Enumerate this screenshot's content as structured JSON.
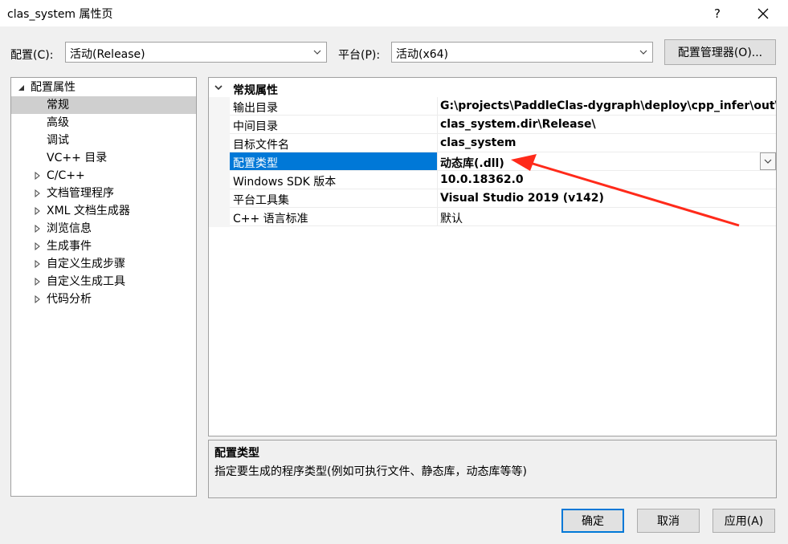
{
  "window": {
    "title": "clas_system 属性页",
    "help_label": "?",
    "close_icon": "close-icon"
  },
  "toolbar": {
    "config_label": "配置(C):",
    "config_value": "活动(Release)",
    "platform_label": "平台(P):",
    "platform_value": "活动(x64)",
    "config_manager_label": "配置管理器(O)..."
  },
  "tree": {
    "root": "配置属性",
    "items": [
      {
        "label": "常规",
        "selected": true
      },
      {
        "label": "高级"
      },
      {
        "label": "调试"
      },
      {
        "label": "VC++ 目录"
      },
      {
        "label": "C/C++"
      },
      {
        "label": "文档管理程序"
      },
      {
        "label": "XML 文档生成器"
      },
      {
        "label": "浏览信息"
      },
      {
        "label": "生成事件"
      },
      {
        "label": "自定义生成步骤"
      },
      {
        "label": "自定义生成工具"
      },
      {
        "label": "代码分析"
      }
    ]
  },
  "grid": {
    "category": "常规属性",
    "rows": [
      {
        "name": "输出目录",
        "value": "G:\\projects\\PaddleClas-dygraph\\deploy\\cpp_infer\\out\\"
      },
      {
        "name": "中间目录",
        "value": "clas_system.dir\\Release\\"
      },
      {
        "name": "目标文件名",
        "value": "clas_system"
      },
      {
        "name": "配置类型",
        "value": "动态库(.dll)",
        "selected": true
      },
      {
        "name": "Windows SDK 版本",
        "value": "10.0.18362.0"
      },
      {
        "name": "平台工具集",
        "value": "Visual Studio 2019 (v142)"
      },
      {
        "name": "C++ 语言标准",
        "value": "默认",
        "normal": true
      }
    ]
  },
  "description": {
    "title": "配置类型",
    "text": "指定要生成的程序类型(例如可执行文件、静态库，动态库等等)"
  },
  "buttons": {
    "ok": "确定",
    "cancel": "取消",
    "apply": "应用(A)"
  },
  "colors": {
    "selection": "#0078d7",
    "annotation_arrow": "#ff2a1a"
  }
}
